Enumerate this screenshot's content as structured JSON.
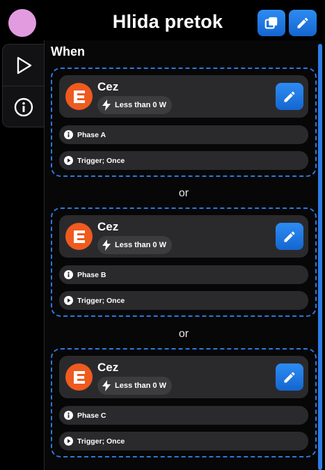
{
  "header": {
    "title": "Hlida pretok",
    "avatar_color": "#e39be0",
    "duplicate_icon": "duplicate-icon",
    "edit_icon": "pencil-icon"
  },
  "sidebar": {
    "items": [
      {
        "icon": "play-outline-icon"
      },
      {
        "icon": "info-circle-icon"
      }
    ]
  },
  "section": {
    "title": "When"
  },
  "separator": "or",
  "groups": [
    {
      "device": "Cez",
      "condition": "Less than 0 W",
      "phase": "Phase A",
      "trigger": "Trigger; Once"
    },
    {
      "device": "Cez",
      "condition": "Less than 0 W",
      "phase": "Phase B",
      "trigger": "Trigger; Once"
    },
    {
      "device": "Cez",
      "condition": "Less than 0 W",
      "phase": "Phase C",
      "trigger": "Trigger; Once"
    }
  ],
  "colors": {
    "accent": "#1e78e6",
    "brand": "#ef5a1f",
    "card": "#2a2a2d",
    "background": "#000000"
  }
}
